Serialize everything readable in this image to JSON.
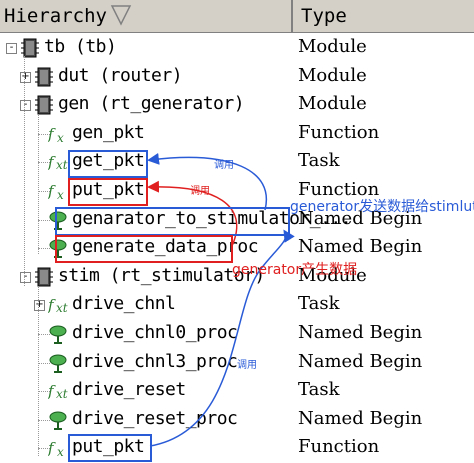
{
  "header": {
    "hierarchy_label": "Hierarchy",
    "type_label": "Type"
  },
  "rows": [
    {
      "label": "tb (tb)",
      "type": "Module",
      "icon": "module-icon"
    },
    {
      "label": "dut (router)",
      "type": "Module",
      "icon": "module-icon"
    },
    {
      "label": "gen (rt_generator)",
      "type": "Module",
      "icon": "module-icon"
    },
    {
      "label": "gen_pkt",
      "type": "Function",
      "icon": "function-icon"
    },
    {
      "label": "get_pkt",
      "type": "Task",
      "icon": "task-icon"
    },
    {
      "label": "put_pkt",
      "type": "Function",
      "icon": "function-icon"
    },
    {
      "label": "genarator_to_stimulator_...",
      "type": "Named Begin",
      "icon": "named-begin-icon"
    },
    {
      "label": "generate_data_proc",
      "type": "Named Begin",
      "icon": "named-begin-icon"
    },
    {
      "label": "stim (rt_stimulator)",
      "type": "Module",
      "icon": "module-icon"
    },
    {
      "label": "drive_chnl",
      "type": "Task",
      "icon": "task-icon"
    },
    {
      "label": "drive_chnl0_proc",
      "type": "Named Begin",
      "icon": "named-begin-icon"
    },
    {
      "label": "drive_chnl3_proc",
      "type": "Named Begin",
      "icon": "named-begin-icon"
    },
    {
      "label": "drive_reset",
      "type": "Task",
      "icon": "task-icon"
    },
    {
      "label": "drive_reset_proc",
      "type": "Named Begin",
      "icon": "named-begin-icon"
    },
    {
      "label": "put_pkt",
      "type": "Function",
      "icon": "function-icon"
    }
  ],
  "annotations": {
    "call_1": "调用",
    "call_2": "调用",
    "call_3": "调用",
    "send_text": "generator发送数据给stimlutor",
    "produce_text": "generator产生数据"
  },
  "colors": {
    "blue": "#2a5bd7",
    "red": "#e02020",
    "header_bg": "#d4d0c8"
  }
}
